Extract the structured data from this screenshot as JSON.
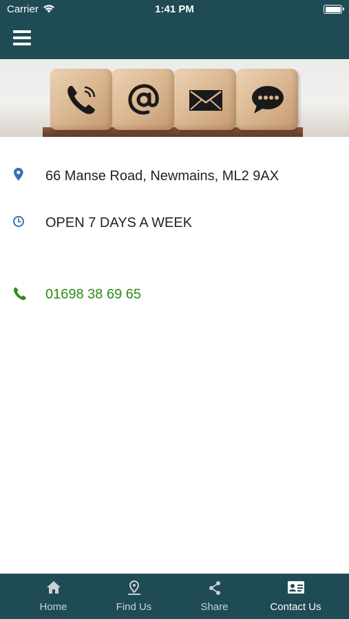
{
  "colors": {
    "header": "#1f4b55",
    "pin_icon": "#3a6fb5",
    "clock_icon": "#3a6fb5",
    "phone_green": "#2e8b17"
  },
  "status_bar": {
    "carrier": "Carrier",
    "time": "1:41 PM"
  },
  "header": {
    "menu_icon": "hamburger-icon"
  },
  "banner": {
    "icons": [
      "phone-icon",
      "at-icon",
      "envelope-icon",
      "chat-icon"
    ]
  },
  "contact": {
    "address": "66 Manse Road, Newmains, ML2 9AX",
    "hours": "OPEN 7 DAYS A WEEK",
    "phone": "01698 38 69 65"
  },
  "tabs": [
    {
      "label": "Home",
      "icon": "home-icon"
    },
    {
      "label": "Find Us",
      "icon": "location-icon"
    },
    {
      "label": "Share",
      "icon": "share-icon"
    },
    {
      "label": "Contact Us",
      "icon": "contact-card-icon",
      "active": true
    }
  ]
}
